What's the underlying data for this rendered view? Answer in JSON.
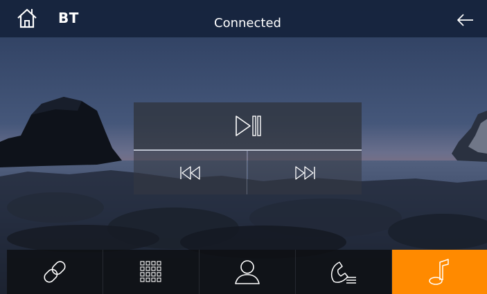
{
  "header": {
    "home_icon": "home-icon",
    "title": "BT",
    "status": "Connected",
    "back_icon": "back-arrow-icon"
  },
  "media_controls": {
    "play_pause_icon": "play-pause-icon",
    "previous_icon": "previous-track-icon",
    "next_icon": "next-track-icon"
  },
  "bottom_nav": {
    "items": [
      {
        "id": "link",
        "icon": "link-icon",
        "active": false
      },
      {
        "id": "dialpad",
        "icon": "dialpad-icon",
        "active": false
      },
      {
        "id": "contacts",
        "icon": "contacts-icon",
        "active": false
      },
      {
        "id": "call-log",
        "icon": "call-log-icon",
        "active": false
      },
      {
        "id": "music",
        "icon": "music-note-icon",
        "active": true
      }
    ]
  },
  "colors": {
    "accent": "#ff8a00",
    "topbar": "#16243c",
    "icon": "#ffffff"
  }
}
